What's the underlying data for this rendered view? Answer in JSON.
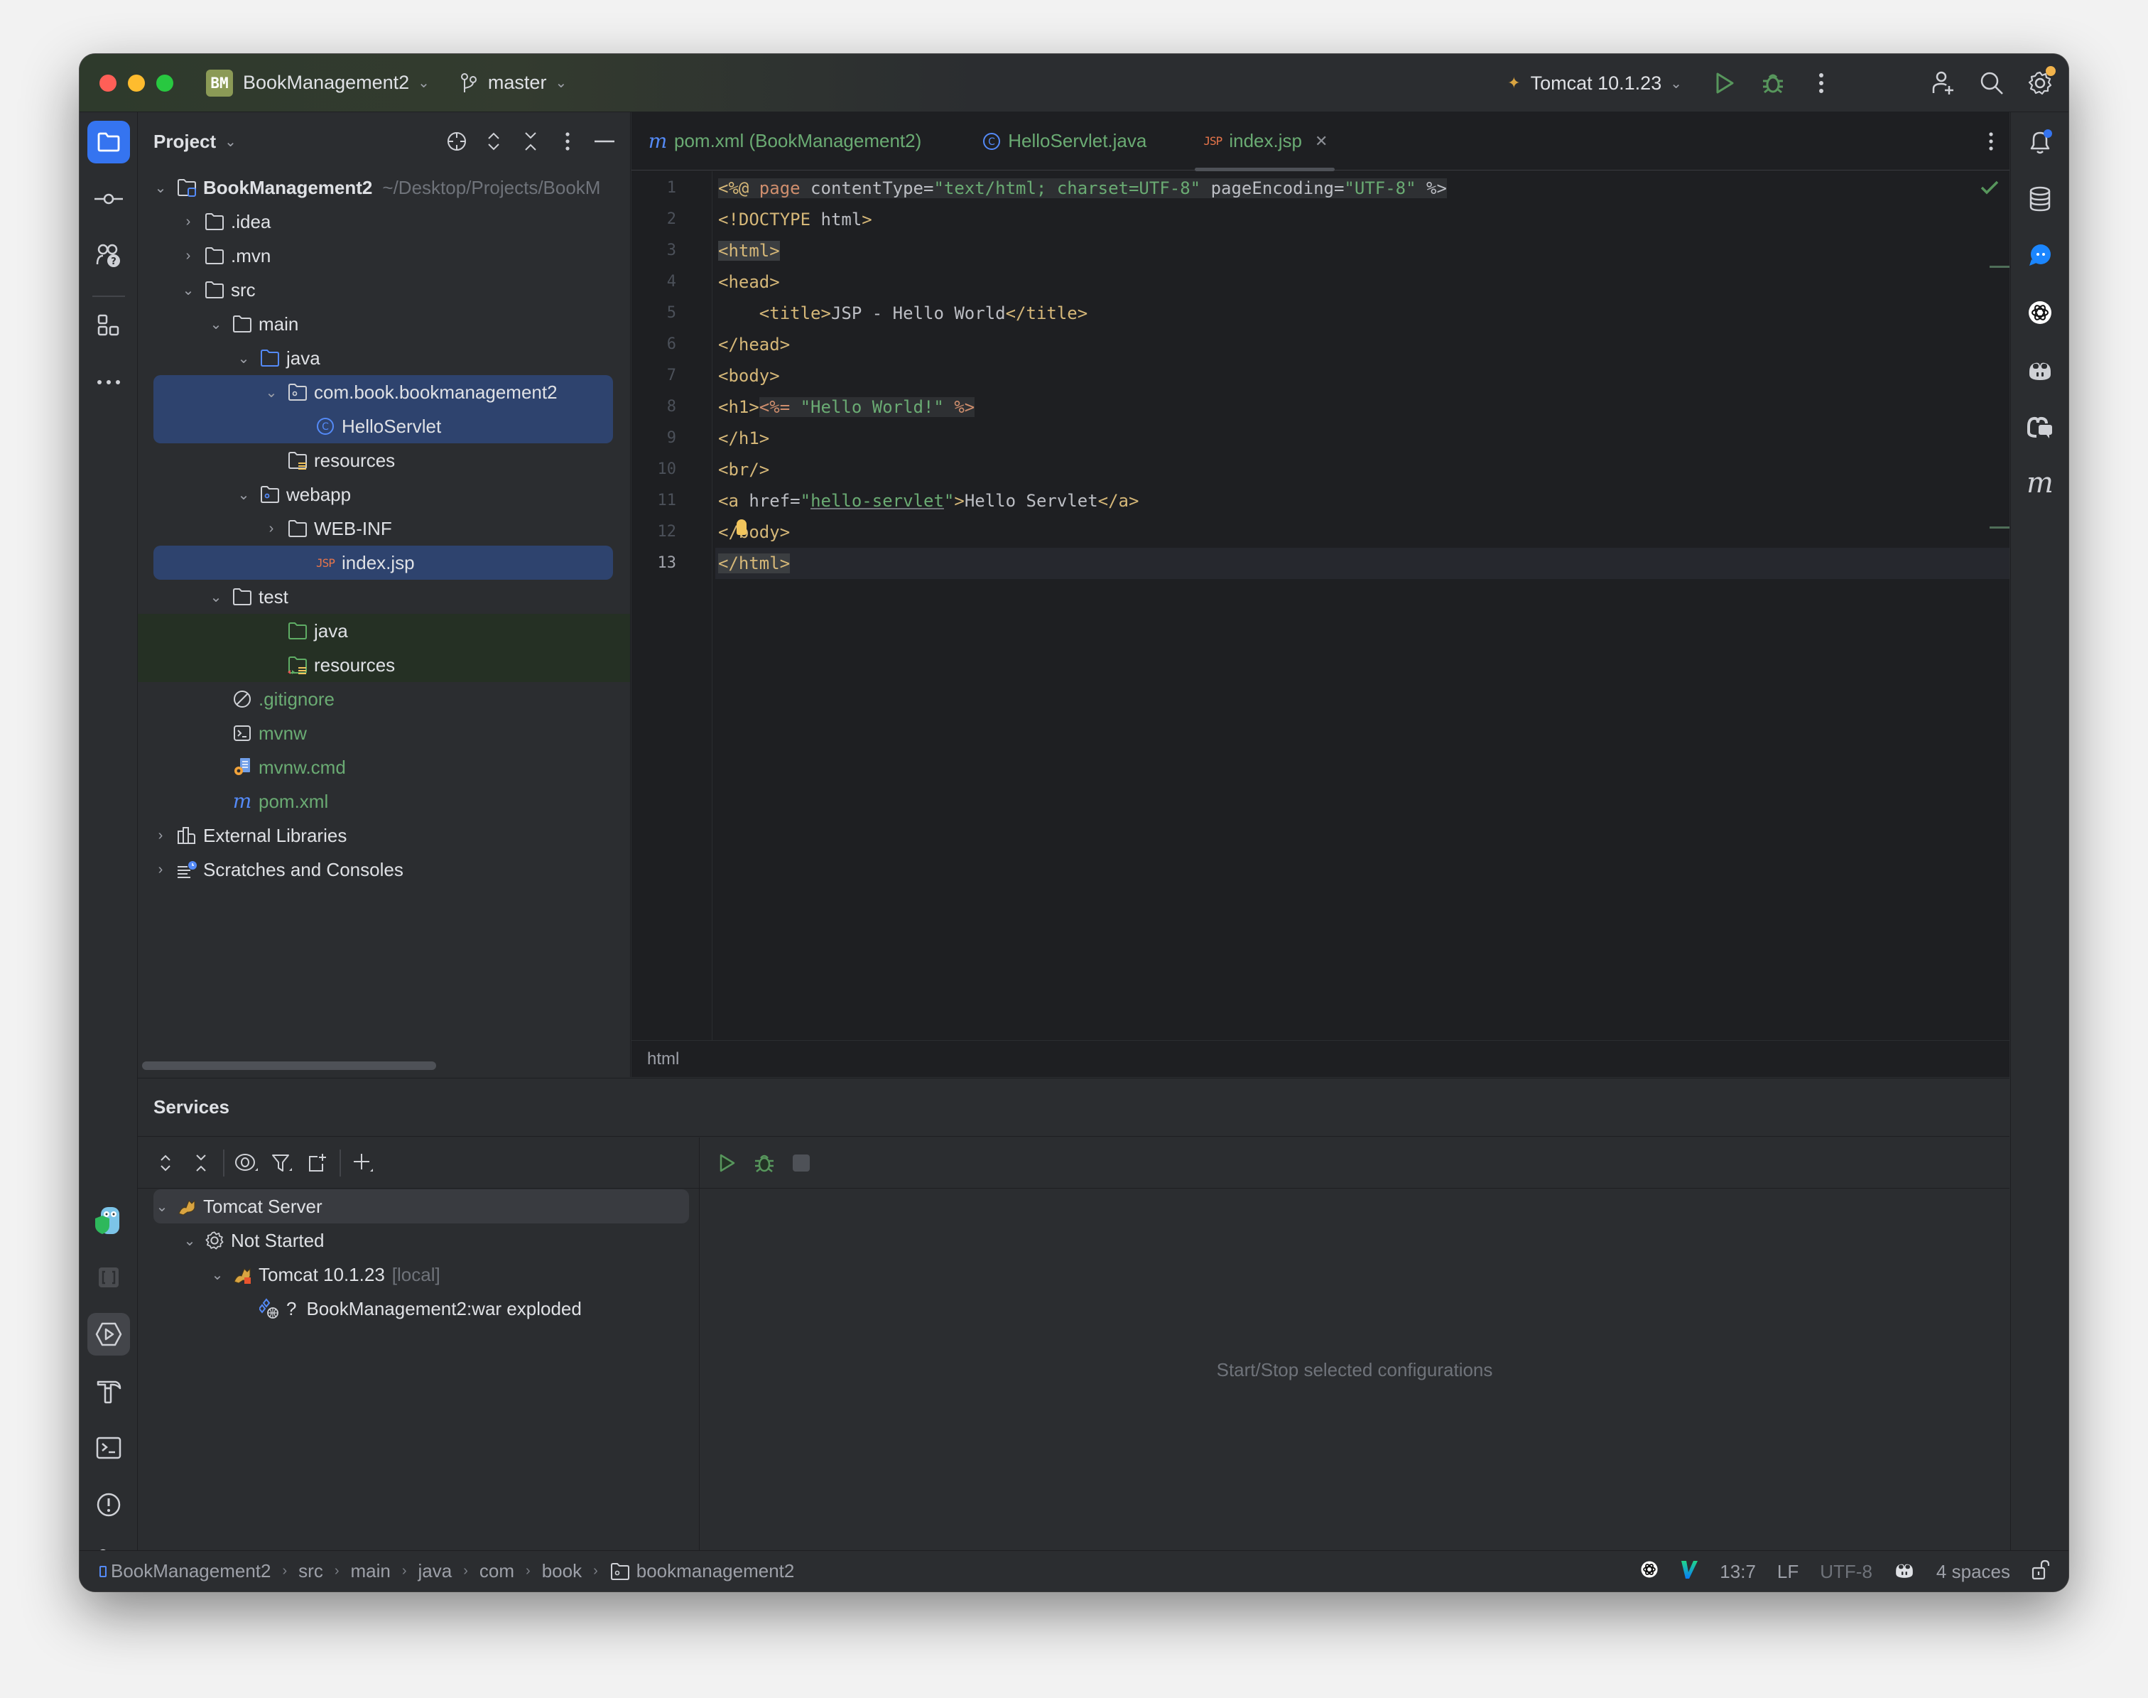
{
  "titlebar": {
    "project_badge": "BM",
    "project_name": "BookManagement2",
    "branch": "master",
    "run_config": "Tomcat 10.1.23",
    "colors": {
      "project_badge": "#8b9a56",
      "run": "#57965c",
      "settings_dot": "#f2b34b"
    }
  },
  "project_panel": {
    "title": "Project",
    "tree": [
      {
        "label": "BookManagement2",
        "suffix": "~/Desktop/Projects/BookM",
        "depth": 0,
        "arrow": "down",
        "icon": "module-folder-icon",
        "bold": true
      },
      {
        "label": ".idea",
        "depth": 1,
        "arrow": "right",
        "icon": "folder-icon"
      },
      {
        "label": ".mvn",
        "depth": 1,
        "arrow": "right",
        "icon": "folder-icon"
      },
      {
        "label": "src",
        "depth": 1,
        "arrow": "down",
        "icon": "folder-icon"
      },
      {
        "label": "main",
        "depth": 2,
        "arrow": "down",
        "icon": "folder-icon"
      },
      {
        "label": "java",
        "depth": 3,
        "arrow": "down",
        "icon": "source-folder-icon"
      },
      {
        "label": "com.book.bookmanagement2",
        "depth": 4,
        "arrow": "down",
        "icon": "package-icon",
        "selected": "first"
      },
      {
        "label": "HelloServlet",
        "depth": 5,
        "arrow": "",
        "icon": "class-icon",
        "selected": "last"
      },
      {
        "label": "resources",
        "depth": 4,
        "arrow": "",
        "icon": "resources-folder-icon"
      },
      {
        "label": "webapp",
        "depth": 3,
        "arrow": "down",
        "icon": "web-folder-icon"
      },
      {
        "label": "WEB-INF",
        "depth": 4,
        "arrow": "right",
        "icon": "folder-icon"
      },
      {
        "label": "index.jsp",
        "depth": 5,
        "arrow": "",
        "icon": "jsp-icon",
        "selected": "single"
      },
      {
        "label": "test",
        "depth": 2,
        "arrow": "down",
        "icon": "folder-icon"
      },
      {
        "label": "java",
        "depth": 4,
        "arrow": "",
        "icon": "test-folder-icon",
        "test": true
      },
      {
        "label": "resources",
        "depth": 4,
        "arrow": "",
        "icon": "test-resources-icon",
        "test": true
      },
      {
        "label": ".gitignore",
        "depth": 2,
        "arrow": "",
        "icon": "ignore-file-icon",
        "green": true
      },
      {
        "label": "mvnw",
        "depth": 2,
        "arrow": "",
        "icon": "shell-script-icon",
        "green": true
      },
      {
        "label": "mvnw.cmd",
        "depth": 2,
        "arrow": "",
        "icon": "batch-file-icon",
        "green": true
      },
      {
        "label": "pom.xml",
        "depth": 2,
        "arrow": "",
        "icon": "maven-icon",
        "green": true
      },
      {
        "label": "External Libraries",
        "depth": 0,
        "arrow": "right",
        "icon": "libraries-icon"
      },
      {
        "label": "Scratches and Consoles",
        "depth": 0,
        "arrow": "right",
        "icon": "scratches-icon"
      }
    ]
  },
  "editor": {
    "tabs": [
      {
        "label": "pom.xml (BookManagement2)",
        "icon": "maven-icon",
        "active": false
      },
      {
        "label": "HelloServlet.java",
        "icon": "class-icon",
        "active": false
      },
      {
        "label": "index.jsp",
        "icon": "jsp-icon",
        "active": true,
        "closable": true
      }
    ],
    "current_line": 13,
    "lines": [
      [
        [
          "tag",
          "<%@ "
        ],
        [
          "kw",
          "page "
        ],
        [
          "txt",
          "contentType="
        ],
        [
          "str",
          "\"text/html; charset=UTF-8\""
        ],
        [
          "txt",
          " pageEncoding="
        ],
        [
          "str",
          "\"UTF-8\""
        ],
        [
          "txt",
          " %>"
        ]
      ],
      [
        [
          "tag",
          "<!DOCTYPE "
        ],
        [
          "txt",
          "html"
        ],
        [
          "tag",
          ">"
        ]
      ],
      [
        [
          "tag",
          "<html>"
        ]
      ],
      [
        [
          "tag",
          "<head>"
        ]
      ],
      [
        [
          "txt",
          "    "
        ],
        [
          "tag",
          "<title>"
        ],
        [
          "txt",
          "JSP - Hello World"
        ],
        [
          "tag",
          "</title>"
        ]
      ],
      [
        [
          "tag",
          "</head>"
        ]
      ],
      [
        [
          "tag",
          "<body>"
        ]
      ],
      [
        [
          "tag",
          "<h1>"
        ],
        [
          "kw",
          "<%= "
        ],
        [
          "str",
          "\"Hello World!\""
        ],
        [
          "kw",
          " %>"
        ]
      ],
      [
        [
          "tag",
          "</h1>"
        ]
      ],
      [
        [
          "tag",
          "<br/>"
        ]
      ],
      [
        [
          "tag",
          "<a "
        ],
        [
          "txt",
          "href="
        ],
        [
          "str",
          "\""
        ],
        [
          "link",
          "hello-servlet"
        ],
        [
          "str",
          "\""
        ],
        [
          "tag",
          ">"
        ],
        [
          "txt",
          "Hello Servlet"
        ],
        [
          "tag",
          "</a>"
        ]
      ],
      [
        [
          "tag",
          "</body>"
        ]
      ],
      [
        [
          "tag",
          "</html>"
        ]
      ]
    ],
    "footer_breadcrumb": "html",
    "syntax_colors": {
      "tag": "#d5b778",
      "keyword": "#cf8e6d",
      "string": "#6aab73",
      "text": "#bcbec4"
    }
  },
  "services": {
    "title": "Services",
    "tree": [
      {
        "label": "Tomcat Server",
        "depth": 0,
        "arrow": "down",
        "icon": "tomcat-icon",
        "selected": true
      },
      {
        "label": "Not Started",
        "depth": 1,
        "arrow": "down",
        "icon": "gear-icon"
      },
      {
        "label": "Tomcat 10.1.23",
        "suffix": "[local]",
        "depth": 2,
        "arrow": "down",
        "icon": "tomcat-stopped-icon"
      },
      {
        "label": "BookManagement2:war exploded",
        "prefix": "?",
        "depth": 3,
        "arrow": "",
        "icon": "artifact-icon"
      }
    ],
    "empty_text": "Start/Stop selected configurations"
  },
  "statusbar": {
    "breadcrumbs": [
      "BookManagement2",
      "src",
      "main",
      "java",
      "com",
      "book",
      "bookmanagement2"
    ],
    "position": "13:7",
    "line_ending": "LF",
    "encoding": "UTF-8",
    "indent": "4 spaces"
  }
}
